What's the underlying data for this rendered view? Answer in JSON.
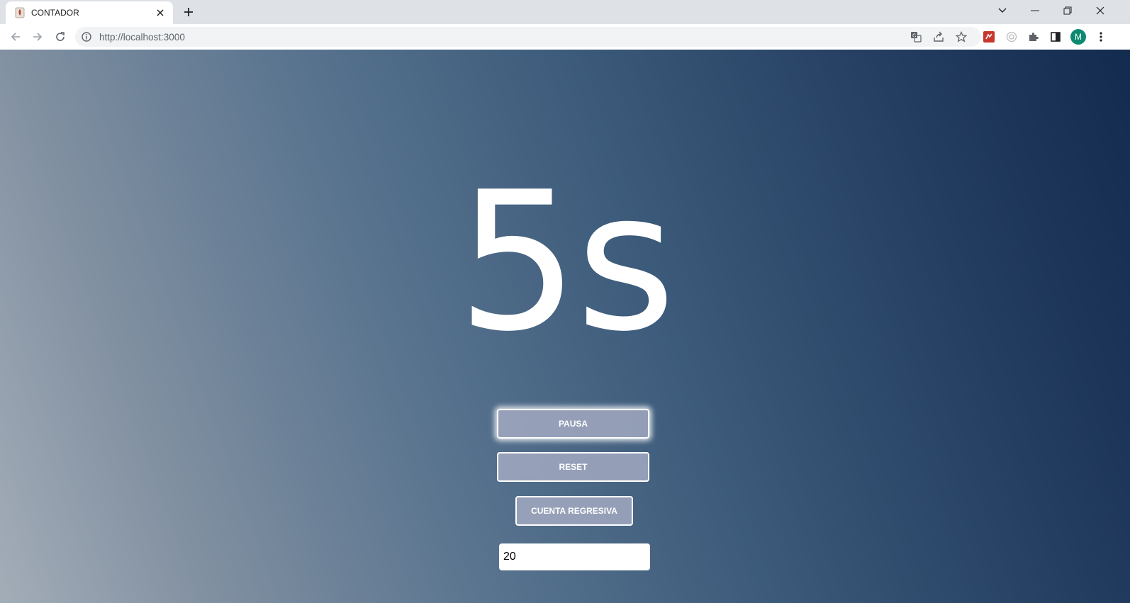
{
  "browser": {
    "tab": {
      "title": "CONTADOR"
    },
    "address_bar": {
      "url": "http://localhost:3000"
    },
    "profile_initial": "M"
  },
  "page": {
    "counter_text": "5s",
    "buttons": {
      "pause_label": "PAUSA",
      "reset_label": "RESET",
      "countdown_label": "CUENTA REGRESIVA"
    },
    "seconds_input": {
      "value": "20"
    }
  },
  "colors": {
    "avatar": "#0b8a6f",
    "gradient_light": "#a3adb8",
    "gradient_dark": "#132b4f",
    "button_fill": "#a8aec4"
  }
}
